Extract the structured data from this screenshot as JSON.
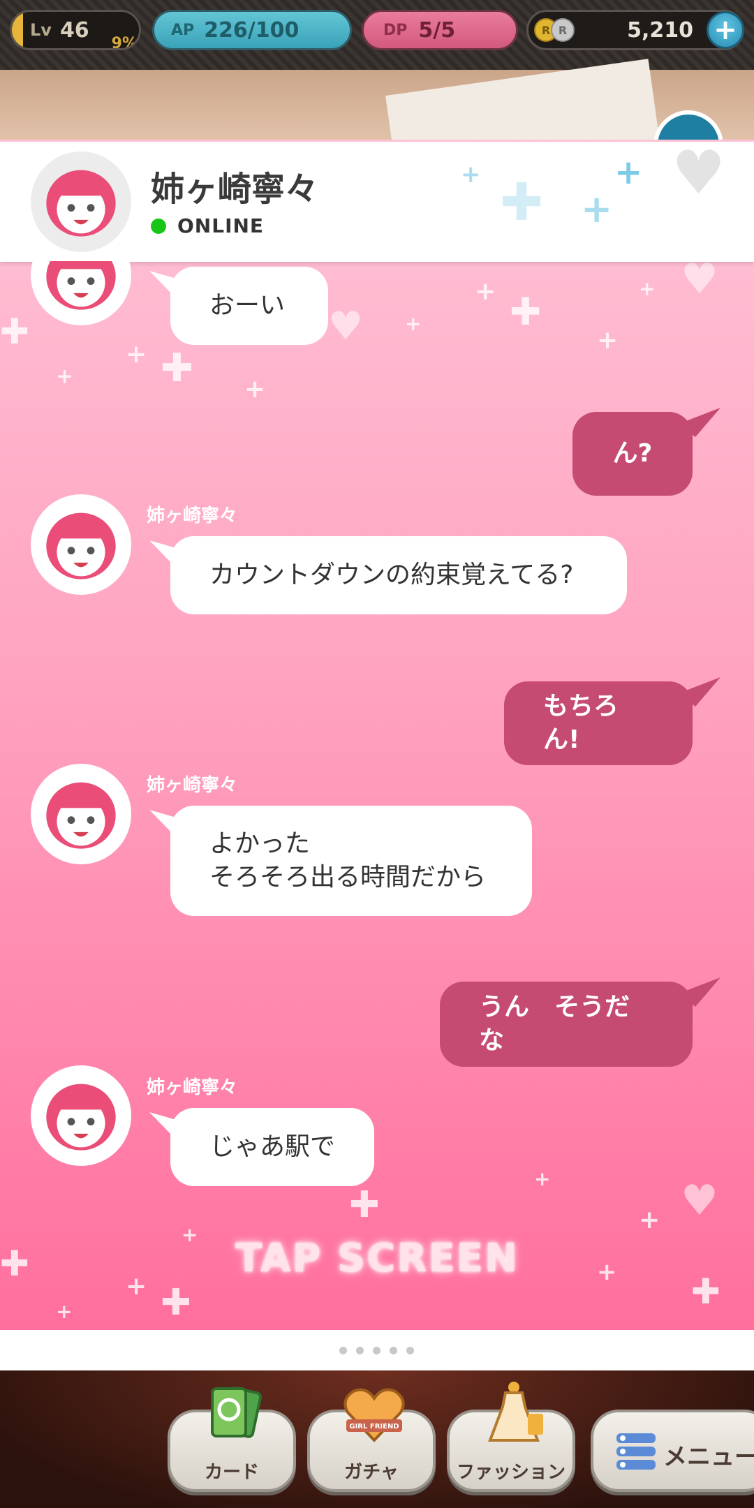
{
  "status_bar": {
    "level_label": "Lv",
    "level_value": "46",
    "level_progress": "9%",
    "ap_label": "AP",
    "ap_value": "226/100",
    "dp_label": "DP",
    "dp_value": "5/5",
    "coin_gold_label": "R",
    "coin_silver_label": "R",
    "coins_value": "5,210",
    "plus_label": "+"
  },
  "chat_header": {
    "name": "姉ヶ崎寧々",
    "status": "ONLINE",
    "status_color": "#17c617"
  },
  "messages": [
    {
      "side": "left",
      "sender": "",
      "text": "おーい"
    },
    {
      "side": "right",
      "text": "ん?"
    },
    {
      "side": "left",
      "sender": "姉ヶ崎寧々",
      "text": "カウントダウンの約束覚えてる?"
    },
    {
      "side": "right",
      "text": "もちろん!"
    },
    {
      "side": "left",
      "sender": "姉ヶ崎寧々",
      "lines": [
        "よかった",
        "そろそろ出る時間だから"
      ]
    },
    {
      "side": "right",
      "text": "うん　そうだな"
    },
    {
      "side": "left",
      "sender": "姉ヶ崎寧々",
      "text": "じゃあ駅で"
    }
  ],
  "tap_prompt": "TAP SCREEN",
  "bottom_nav": {
    "card": "カード",
    "gacha": "ガチャ",
    "gacha_badge": "GIRL FRIEND",
    "fashion": "ファッション",
    "menu": "メニュー"
  },
  "colors": {
    "accent_right_bubble": "#c54b73",
    "chat_bg_top": "#ffc3d7",
    "chat_bg_bottom": "#ff6f9d"
  }
}
